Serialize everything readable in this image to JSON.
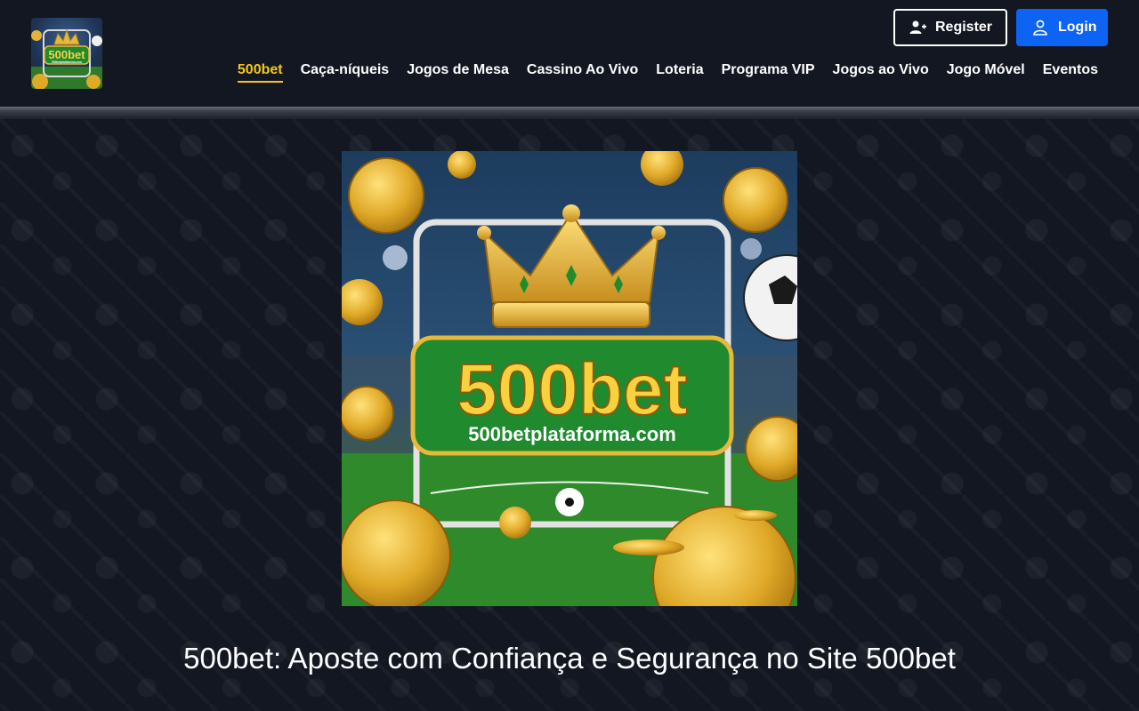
{
  "brand": {
    "logo_text": "500bet",
    "logo_subtext": "500betplataforma.com"
  },
  "auth": {
    "register_label": "Register",
    "login_label": "Login"
  },
  "nav": [
    {
      "label": "500bet",
      "active": true
    },
    {
      "label": "Caça-níqueis"
    },
    {
      "label": "Jogos de Mesa"
    },
    {
      "label": "Cassino Ao Vivo"
    },
    {
      "label": "Loteria"
    },
    {
      "label": "Programa VIP"
    },
    {
      "label": "Jogos ao Vivo"
    },
    {
      "label": "Jogo Móvel"
    },
    {
      "label": "Eventos"
    }
  ],
  "hero": {
    "brand_text": "500bet",
    "domain_text": "500betplataforma.com"
  },
  "page": {
    "title": "500bet: Aposte com Confiança e Segurança no Site 500bet"
  },
  "colors": {
    "background": "#121722",
    "accent_yellow": "#f5c518",
    "login_blue": "#0d63f3",
    "badge_green": "#1f8a2e"
  }
}
